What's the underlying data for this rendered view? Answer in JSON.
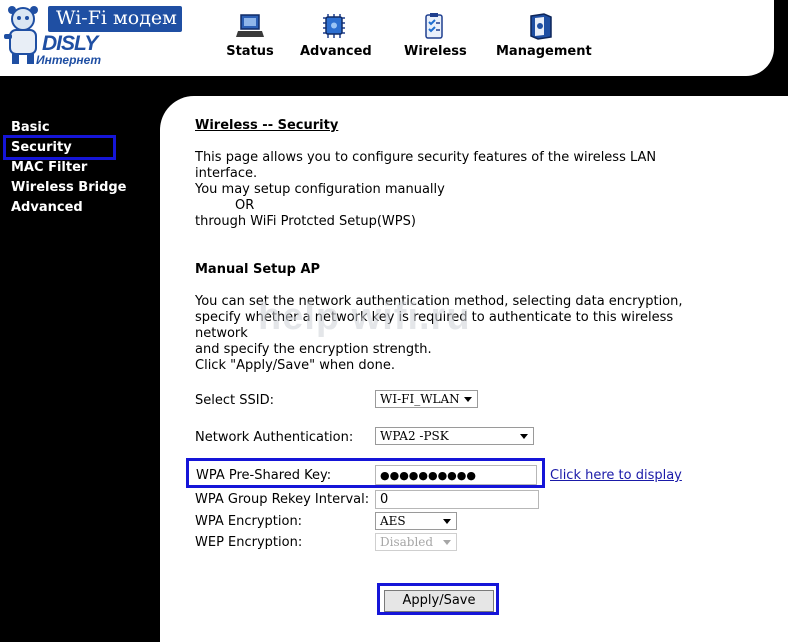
{
  "logo": {
    "badge_text": "Wi-Fi модем",
    "brand": "DISLY",
    "subtitle": "Интернет"
  },
  "nav": [
    {
      "label": "Status",
      "icon": "laptop-icon"
    },
    {
      "label": "Advanced",
      "icon": "chip-icon"
    },
    {
      "label": "Wireless",
      "icon": "clipboard-icon"
    },
    {
      "label": "Management",
      "icon": "book-icon"
    }
  ],
  "sidebar": {
    "items": [
      {
        "label": "Basic",
        "selected": false
      },
      {
        "label": "Security",
        "selected": true
      },
      {
        "label": "MAC Filter",
        "selected": false
      },
      {
        "label": "Wireless Bridge",
        "selected": false
      },
      {
        "label": "Advanced",
        "selected": false
      }
    ]
  },
  "page": {
    "title": "Wireless -- Security",
    "intro": [
      "This page allows you to configure security features of the wireless LAN",
      "interface.",
      "You may setup configuration manually",
      "OR",
      "through WiFi Protcted Setup(WPS)"
    ],
    "section_title": "Manual Setup AP",
    "desc": [
      "You can set the network authentication method, selecting data encryption,",
      "specify whether a network key is required to authenticate to this wireless",
      "network",
      "and specify the encryption strength.",
      "Click \"Apply/Save\" when done."
    ]
  },
  "form": {
    "ssid_label": "Select SSID:",
    "ssid_value": "WI-FI_WLAN",
    "auth_label": "Network Authentication:",
    "auth_value": "WPA2 -PSK",
    "psk_label": "WPA Pre-Shared Key:",
    "psk_value": "●●●●●●●●●●",
    "display_link": "Click here to display",
    "rekey_label": "WPA Group Rekey Interval:",
    "rekey_value": "0",
    "wpa_enc_label": "WPA Encryption:",
    "wpa_enc_value": "AES",
    "wep_enc_label": "WEP Encryption:",
    "wep_enc_value": "Disabled",
    "apply_label": "Apply/Save"
  },
  "watermark": "help wifi.ru",
  "colors": {
    "accent_highlight": "#1515d8",
    "logo_blue": "#1f4fa3",
    "link": "#1a1aa8"
  }
}
